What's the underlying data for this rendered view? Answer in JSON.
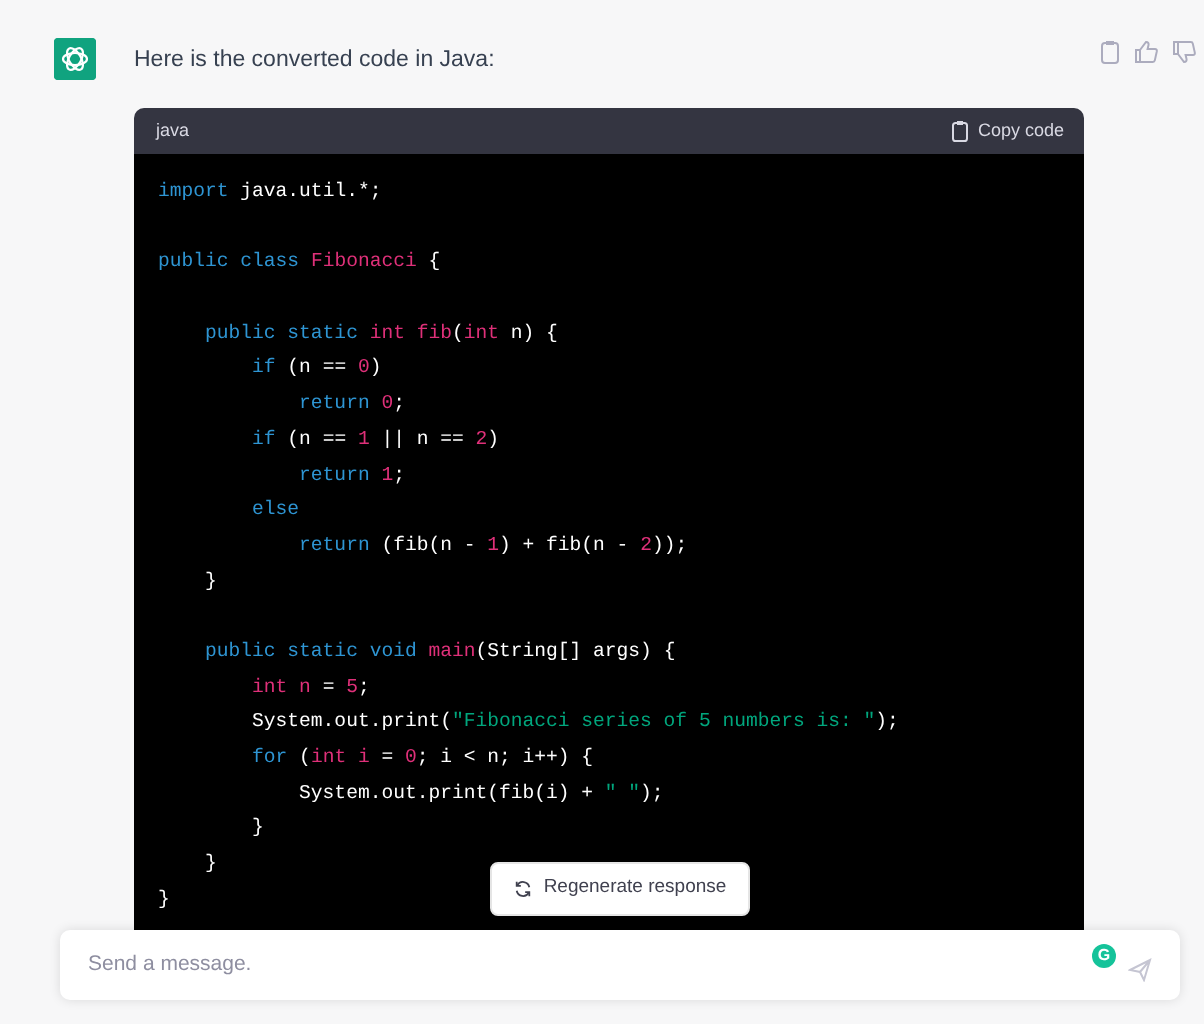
{
  "message": {
    "text": "Here is the converted code in Java:"
  },
  "code_block": {
    "language": "java",
    "copy_label": "Copy code",
    "lines": [
      {
        "kind": "code",
        "tokens": [
          {
            "kind": "keyword",
            "text": "import"
          },
          {
            "kind": "plain",
            "text": " java.util.*;"
          }
        ]
      },
      {
        "kind": "blank"
      },
      {
        "kind": "code",
        "tokens": [
          {
            "kind": "keyword",
            "text": "public class"
          },
          {
            "kind": "name",
            "text": " Fibonacci"
          },
          {
            "kind": "plain",
            "text": " {"
          }
        ]
      },
      {
        "kind": "blank"
      },
      {
        "kind": "code",
        "tokens": [
          {
            "kind": "keyword",
            "text": "    public static"
          },
          {
            "kind": "name",
            "text": " int fib"
          },
          {
            "kind": "plain",
            "text": "("
          },
          {
            "kind": "name",
            "text": "int"
          },
          {
            "kind": "plain",
            "text": " n) {"
          }
        ]
      },
      {
        "kind": "code",
        "tokens": [
          {
            "kind": "keyword",
            "text": "        if"
          },
          {
            "kind": "plain",
            "text": " (n == "
          },
          {
            "kind": "name",
            "text": "0"
          },
          {
            "kind": "plain",
            "text": ")"
          }
        ]
      },
      {
        "kind": "code",
        "tokens": [
          {
            "kind": "keyword",
            "text": "            return"
          },
          {
            "kind": "name",
            "text": " 0"
          },
          {
            "kind": "plain",
            "text": ";"
          }
        ]
      },
      {
        "kind": "code",
        "tokens": [
          {
            "kind": "keyword",
            "text": "        if"
          },
          {
            "kind": "plain",
            "text": " (n == "
          },
          {
            "kind": "name",
            "text": "1"
          },
          {
            "kind": "plain",
            "text": " || n == "
          },
          {
            "kind": "name",
            "text": "2"
          },
          {
            "kind": "plain",
            "text": ")"
          }
        ]
      },
      {
        "kind": "code",
        "tokens": [
          {
            "kind": "keyword",
            "text": "            return"
          },
          {
            "kind": "name",
            "text": " 1"
          },
          {
            "kind": "plain",
            "text": ";"
          }
        ]
      },
      {
        "kind": "code",
        "tokens": [
          {
            "kind": "keyword",
            "text": "        else"
          }
        ]
      },
      {
        "kind": "code",
        "tokens": [
          {
            "kind": "keyword",
            "text": "            return"
          },
          {
            "kind": "plain",
            "text": " (fib(n - "
          },
          {
            "kind": "name",
            "text": "1"
          },
          {
            "kind": "plain",
            "text": ") + fib(n - "
          },
          {
            "kind": "name",
            "text": "2"
          },
          {
            "kind": "plain",
            "text": "));"
          }
        ]
      },
      {
        "kind": "code",
        "tokens": [
          {
            "kind": "plain",
            "text": "    }"
          }
        ]
      },
      {
        "kind": "blank"
      },
      {
        "kind": "code",
        "tokens": [
          {
            "kind": "keyword",
            "text": "    public static void"
          },
          {
            "kind": "name",
            "text": " main"
          },
          {
            "kind": "plain",
            "text": "(String[] args) {"
          }
        ]
      },
      {
        "kind": "code",
        "tokens": [
          {
            "kind": "name",
            "text": "        int n"
          },
          {
            "kind": "plain",
            "text": " = "
          },
          {
            "kind": "name",
            "text": "5"
          },
          {
            "kind": "plain",
            "text": ";"
          }
        ]
      },
      {
        "kind": "code",
        "tokens": [
          {
            "kind": "plain",
            "text": "        System.out.print("
          },
          {
            "kind": "string",
            "text": "\"Fibonacci series of 5 numbers is: \""
          },
          {
            "kind": "plain",
            "text": ");"
          }
        ]
      },
      {
        "kind": "code",
        "tokens": [
          {
            "kind": "keyword",
            "text": "        for"
          },
          {
            "kind": "plain",
            "text": " ("
          },
          {
            "kind": "name",
            "text": "int i"
          },
          {
            "kind": "plain",
            "text": " = "
          },
          {
            "kind": "name",
            "text": "0"
          },
          {
            "kind": "plain",
            "text": "; i < n; i++) {"
          }
        ]
      },
      {
        "kind": "code",
        "tokens": [
          {
            "kind": "plain",
            "text": "            System.out.print(fib(i) + "
          },
          {
            "kind": "string",
            "text": "\" \""
          },
          {
            "kind": "plain",
            "text": ");"
          }
        ]
      },
      {
        "kind": "code",
        "tokens": [
          {
            "kind": "plain",
            "text": "        }"
          }
        ]
      },
      {
        "kind": "code",
        "tokens": [
          {
            "kind": "plain",
            "text": "    }"
          }
        ]
      },
      {
        "kind": "code",
        "tokens": [
          {
            "kind": "plain",
            "text": "}"
          }
        ]
      }
    ]
  },
  "regenerate_button": "Regenerate response",
  "composer": {
    "placeholder": "Send a message.",
    "grammar_badge": "G"
  }
}
